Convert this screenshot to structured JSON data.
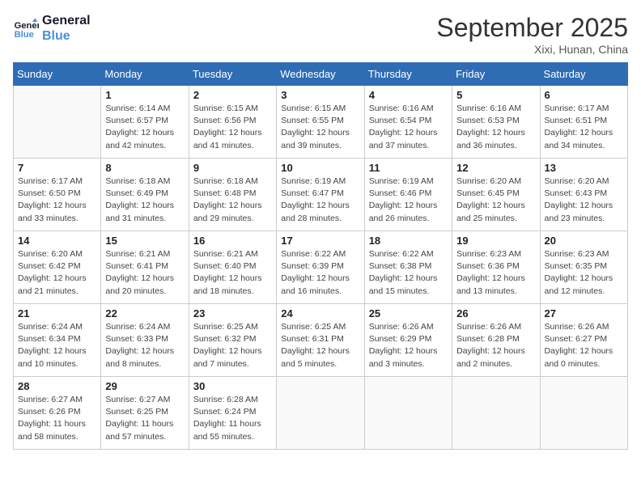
{
  "header": {
    "logo_line1": "General",
    "logo_line2": "Blue",
    "month_title": "September 2025",
    "location": "Xixi, Hunan, China"
  },
  "weekdays": [
    "Sunday",
    "Monday",
    "Tuesday",
    "Wednesday",
    "Thursday",
    "Friday",
    "Saturday"
  ],
  "weeks": [
    [
      {
        "day": "",
        "info": ""
      },
      {
        "day": "1",
        "info": "Sunrise: 6:14 AM\nSunset: 6:57 PM\nDaylight: 12 hours\nand 42 minutes."
      },
      {
        "day": "2",
        "info": "Sunrise: 6:15 AM\nSunset: 6:56 PM\nDaylight: 12 hours\nand 41 minutes."
      },
      {
        "day": "3",
        "info": "Sunrise: 6:15 AM\nSunset: 6:55 PM\nDaylight: 12 hours\nand 39 minutes."
      },
      {
        "day": "4",
        "info": "Sunrise: 6:16 AM\nSunset: 6:54 PM\nDaylight: 12 hours\nand 37 minutes."
      },
      {
        "day": "5",
        "info": "Sunrise: 6:16 AM\nSunset: 6:53 PM\nDaylight: 12 hours\nand 36 minutes."
      },
      {
        "day": "6",
        "info": "Sunrise: 6:17 AM\nSunset: 6:51 PM\nDaylight: 12 hours\nand 34 minutes."
      }
    ],
    [
      {
        "day": "7",
        "info": "Sunrise: 6:17 AM\nSunset: 6:50 PM\nDaylight: 12 hours\nand 33 minutes."
      },
      {
        "day": "8",
        "info": "Sunrise: 6:18 AM\nSunset: 6:49 PM\nDaylight: 12 hours\nand 31 minutes."
      },
      {
        "day": "9",
        "info": "Sunrise: 6:18 AM\nSunset: 6:48 PM\nDaylight: 12 hours\nand 29 minutes."
      },
      {
        "day": "10",
        "info": "Sunrise: 6:19 AM\nSunset: 6:47 PM\nDaylight: 12 hours\nand 28 minutes."
      },
      {
        "day": "11",
        "info": "Sunrise: 6:19 AM\nSunset: 6:46 PM\nDaylight: 12 hours\nand 26 minutes."
      },
      {
        "day": "12",
        "info": "Sunrise: 6:20 AM\nSunset: 6:45 PM\nDaylight: 12 hours\nand 25 minutes."
      },
      {
        "day": "13",
        "info": "Sunrise: 6:20 AM\nSunset: 6:43 PM\nDaylight: 12 hours\nand 23 minutes."
      }
    ],
    [
      {
        "day": "14",
        "info": "Sunrise: 6:20 AM\nSunset: 6:42 PM\nDaylight: 12 hours\nand 21 minutes."
      },
      {
        "day": "15",
        "info": "Sunrise: 6:21 AM\nSunset: 6:41 PM\nDaylight: 12 hours\nand 20 minutes."
      },
      {
        "day": "16",
        "info": "Sunrise: 6:21 AM\nSunset: 6:40 PM\nDaylight: 12 hours\nand 18 minutes."
      },
      {
        "day": "17",
        "info": "Sunrise: 6:22 AM\nSunset: 6:39 PM\nDaylight: 12 hours\nand 16 minutes."
      },
      {
        "day": "18",
        "info": "Sunrise: 6:22 AM\nSunset: 6:38 PM\nDaylight: 12 hours\nand 15 minutes."
      },
      {
        "day": "19",
        "info": "Sunrise: 6:23 AM\nSunset: 6:36 PM\nDaylight: 12 hours\nand 13 minutes."
      },
      {
        "day": "20",
        "info": "Sunrise: 6:23 AM\nSunset: 6:35 PM\nDaylight: 12 hours\nand 12 minutes."
      }
    ],
    [
      {
        "day": "21",
        "info": "Sunrise: 6:24 AM\nSunset: 6:34 PM\nDaylight: 12 hours\nand 10 minutes."
      },
      {
        "day": "22",
        "info": "Sunrise: 6:24 AM\nSunset: 6:33 PM\nDaylight: 12 hours\nand 8 minutes."
      },
      {
        "day": "23",
        "info": "Sunrise: 6:25 AM\nSunset: 6:32 PM\nDaylight: 12 hours\nand 7 minutes."
      },
      {
        "day": "24",
        "info": "Sunrise: 6:25 AM\nSunset: 6:31 PM\nDaylight: 12 hours\nand 5 minutes."
      },
      {
        "day": "25",
        "info": "Sunrise: 6:26 AM\nSunset: 6:29 PM\nDaylight: 12 hours\nand 3 minutes."
      },
      {
        "day": "26",
        "info": "Sunrise: 6:26 AM\nSunset: 6:28 PM\nDaylight: 12 hours\nand 2 minutes."
      },
      {
        "day": "27",
        "info": "Sunrise: 6:26 AM\nSunset: 6:27 PM\nDaylight: 12 hours\nand 0 minutes."
      }
    ],
    [
      {
        "day": "28",
        "info": "Sunrise: 6:27 AM\nSunset: 6:26 PM\nDaylight: 11 hours\nand 58 minutes."
      },
      {
        "day": "29",
        "info": "Sunrise: 6:27 AM\nSunset: 6:25 PM\nDaylight: 11 hours\nand 57 minutes."
      },
      {
        "day": "30",
        "info": "Sunrise: 6:28 AM\nSunset: 6:24 PM\nDaylight: 11 hours\nand 55 minutes."
      },
      {
        "day": "",
        "info": ""
      },
      {
        "day": "",
        "info": ""
      },
      {
        "day": "",
        "info": ""
      },
      {
        "day": "",
        "info": ""
      }
    ]
  ]
}
